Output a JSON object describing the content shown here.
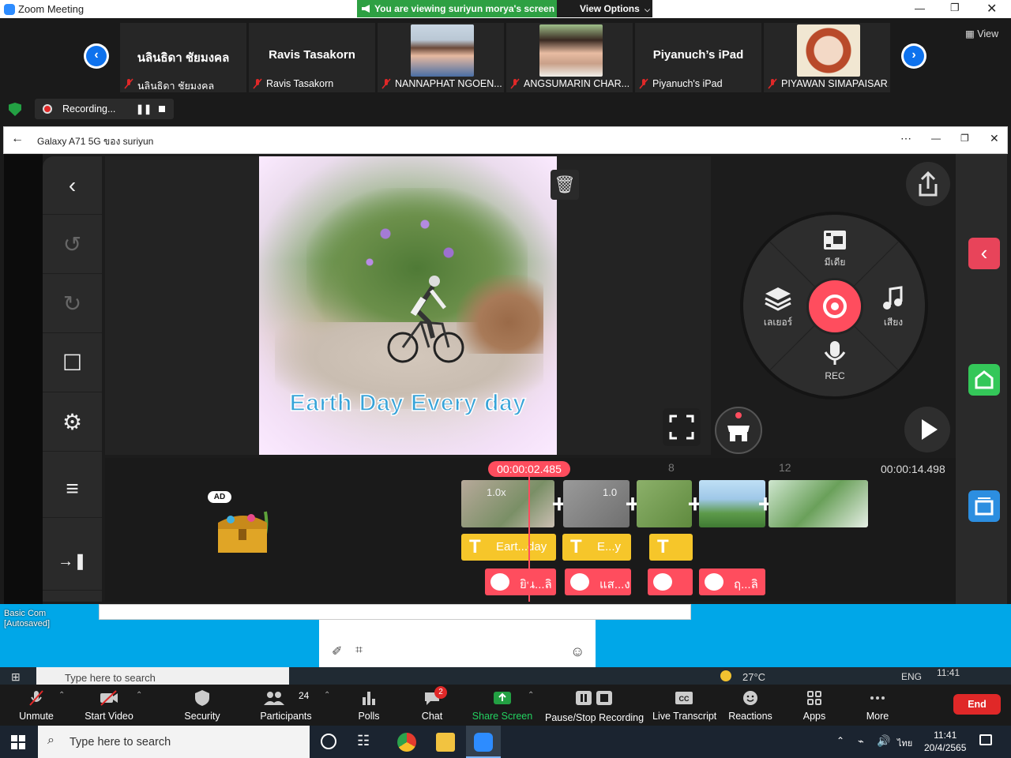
{
  "zoom": {
    "window_title": "Zoom Meeting",
    "viewing_banner": "You are viewing suriyun morya's screen",
    "view_options": "View Options",
    "view_button": "View",
    "recording_status": "Recording...",
    "participants": [
      {
        "display": "นลินธิดา ชัยมงคล",
        "label": "นลินธิดา ชัยมงคล",
        "has_photo": false
      },
      {
        "display": "Ravis Tasakorn",
        "label": "Ravis Tasakorn",
        "has_photo": false
      },
      {
        "display": "",
        "label": "NANNAPHAT NGOEN...",
        "has_photo": true
      },
      {
        "display": "",
        "label": "ANGSUMARIN CHAR...",
        "has_photo": true
      },
      {
        "display": "Piyanuch’s iPad",
        "label": "Piyanuch's iPad",
        "has_photo": false
      },
      {
        "display": "",
        "label": "PIYAWAN SIMAPAISAR...",
        "has_photo": true
      }
    ],
    "controls": {
      "unmute": "Unmute",
      "start_video": "Start Video",
      "security": "Security",
      "participants": "Participants",
      "participants_count": "24",
      "polls": "Polls",
      "chat": "Chat",
      "chat_badge": "2",
      "share_screen": "Share Screen",
      "pause_stop_recording": "Pause/Stop Recording",
      "live_transcript": "Live Transcript",
      "reactions": "Reactions",
      "apps": "Apps",
      "more": "More",
      "end": "End"
    }
  },
  "shared_window": {
    "title": "Galaxy A71 5G ของ suriyun"
  },
  "kinemaster": {
    "preview_text": "Earth Day Every day",
    "wheel": {
      "media": "มีเดีย",
      "layer": "เลเยอร์",
      "audio": "เสียง",
      "rec": "REC"
    },
    "playhead_time": "00:00:02.485",
    "end_time": "00:00:14.498",
    "ruler_marks": [
      "8",
      "12"
    ],
    "ad_label": "AD",
    "clips": [
      {
        "speed": "1.0x"
      },
      {
        "speed": "1.0"
      },
      {
        "speed": ""
      },
      {
        "speed": ""
      },
      {
        "speed": ""
      }
    ],
    "text_tracks": [
      "Eart...day",
      "E...y",
      ""
    ],
    "sticker_tracks": [
      "ยิน...ลิ",
      "แส...ง",
      "",
      "ฤ...ลิ"
    ]
  },
  "desktop": {
    "file_label_1": "Basic Com",
    "file_label_2": "[Autosaved]",
    "inner_search": "Type here to search",
    "inner_weather": "27°C",
    "inner_lang": "ENG",
    "inner_time": "11:41"
  },
  "taskbar": {
    "search_placeholder": "Type here to search",
    "lang": "ไทย",
    "time": "11:41",
    "date": "20/4/2565"
  },
  "colors": {
    "zoom_blue": "#0e72ed",
    "banner_green": "#2ea043",
    "km_red": "#ff4d5e",
    "km_yellow": "#f6c62a",
    "end_red": "#e02828"
  }
}
